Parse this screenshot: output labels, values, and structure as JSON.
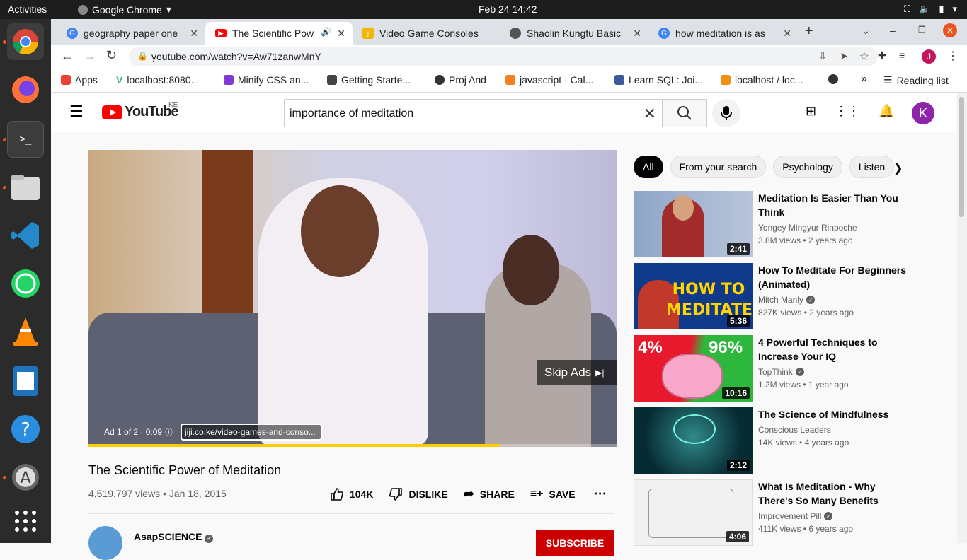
{
  "system": {
    "activities": "Activities",
    "app_name": "Google Chrome",
    "clock": "Feb 24  14:42"
  },
  "tabs": [
    {
      "title": "geography paper one",
      "color": "#4285f4"
    },
    {
      "title": "The Scientific Pow",
      "color": "#ff0000"
    },
    {
      "title": "Video Game Consoles",
      "color": "#f4b400"
    },
    {
      "title": "Shaolin Kungfu Basic",
      "color": "#555555"
    },
    {
      "title": "how meditation is as",
      "color": "#4285f4"
    }
  ],
  "toolbar": {
    "url": "youtube.com/watch?v=Aw71zanwMnY",
    "profile_initial": "J"
  },
  "bookmarks": {
    "items": [
      "Apps",
      "localhost:8080...",
      "Minify CSS an...",
      "Getting Starte...",
      "Proj And",
      "javascript - Cal...",
      "Learn SQL: Joi...",
      "localhost / loc..."
    ],
    "more": "»",
    "reading_list": "Reading list"
  },
  "youtube": {
    "logo_text": "YouTube",
    "country": "KE",
    "search_query": "importance of meditation",
    "avatar_initial": "K"
  },
  "player": {
    "skip_label": "Skip Ads",
    "ad_info": "Ad 1 of 2 · 0:09",
    "ad_link": "jiji.co.ke/video-games-and-conso...",
    "progress": 0.78
  },
  "video": {
    "title": "The Scientific Power of Meditation",
    "meta": "4,519,797 views • Jan 18, 2015",
    "likes": "104K",
    "dislike": "DISLIKE",
    "share": "SHARE",
    "save": "SAVE",
    "channel": "AsapSCIENCE",
    "subscribe": "SUBSCRIBE"
  },
  "chips": [
    "All",
    "From your search",
    "Psychology",
    "Listen"
  ],
  "recommendations": [
    {
      "title": "Meditation Is Easier Than You Think",
      "channel": "Yongey Mingyur Rinpoche",
      "verified": false,
      "stats": "3.8M views • 2 years ago",
      "duration": "2:41"
    },
    {
      "title": "How To Meditate For Beginners (Animated)",
      "channel": "Mitch Manly",
      "verified": true,
      "stats": "827K views • 2 years ago",
      "duration": "5:36",
      "thumb_text": "HOW TO MEDITATE"
    },
    {
      "title": "4 Powerful Techniques to Increase Your IQ",
      "channel": "TopThink",
      "verified": true,
      "stats": "1.2M views • 1 year ago",
      "duration": "10:16",
      "thumb_left": "4%",
      "thumb_right": "96%"
    },
    {
      "title": "The Science of Mindfulness",
      "channel": "Conscious Leaders",
      "verified": false,
      "stats": "14K views • 4 years ago",
      "duration": "2:12"
    },
    {
      "title": "What Is Meditation - Why There's So Many Benefits",
      "channel": "Improvement Pill",
      "verified": true,
      "stats": "411K views • 6 years ago",
      "duration": "4:06"
    }
  ]
}
